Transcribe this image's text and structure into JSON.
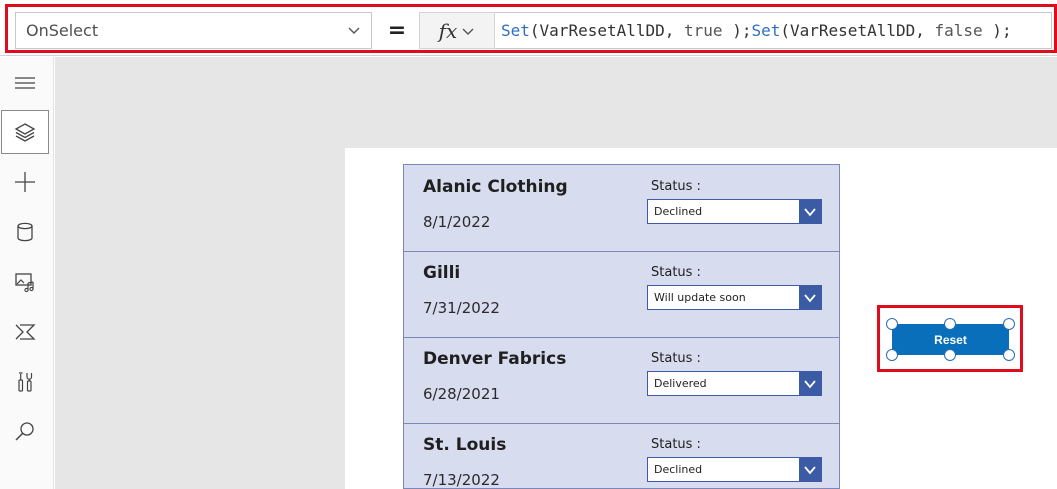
{
  "formula_bar": {
    "property": "OnSelect",
    "equals": "=",
    "fx_label": "fx",
    "formula": {
      "fn1": "Set",
      "args1_open": "(VarResetAllDD, ",
      "kw1": "true",
      "args1_close": " );",
      "fn2": "Set",
      "args2_open": "(VarResetAllDD, ",
      "kw2": "false",
      "args2_close": " );"
    }
  },
  "left_rail": {
    "items": [
      {
        "icon": "hamburger-menu-icon"
      },
      {
        "icon": "layers-icon",
        "active": true
      },
      {
        "icon": "plus-icon"
      },
      {
        "icon": "database-icon"
      },
      {
        "icon": "media-icon"
      },
      {
        "icon": "power-automate-icon"
      },
      {
        "icon": "tools-icon"
      },
      {
        "icon": "search-icon"
      }
    ]
  },
  "gallery": {
    "status_label": "Status :",
    "rows": [
      {
        "title": "Alanic Clothing",
        "date": "8/1/2022",
        "status": "Declined"
      },
      {
        "title": "Gilli",
        "date": "7/31/2022",
        "status": "Will update soon"
      },
      {
        "title": "Denver Fabrics",
        "date": "6/28/2021",
        "status": "Delivered"
      },
      {
        "title": "St. Louis",
        "date": "7/13/2022",
        "status": "Declined"
      }
    ]
  },
  "reset_button": {
    "label": "Reset"
  },
  "colors": {
    "highlight": "#e00b1c",
    "button_blue": "#0a6fba",
    "gallery_bg": "#d7dcef",
    "dropdown_btn": "#3b5ba5"
  }
}
